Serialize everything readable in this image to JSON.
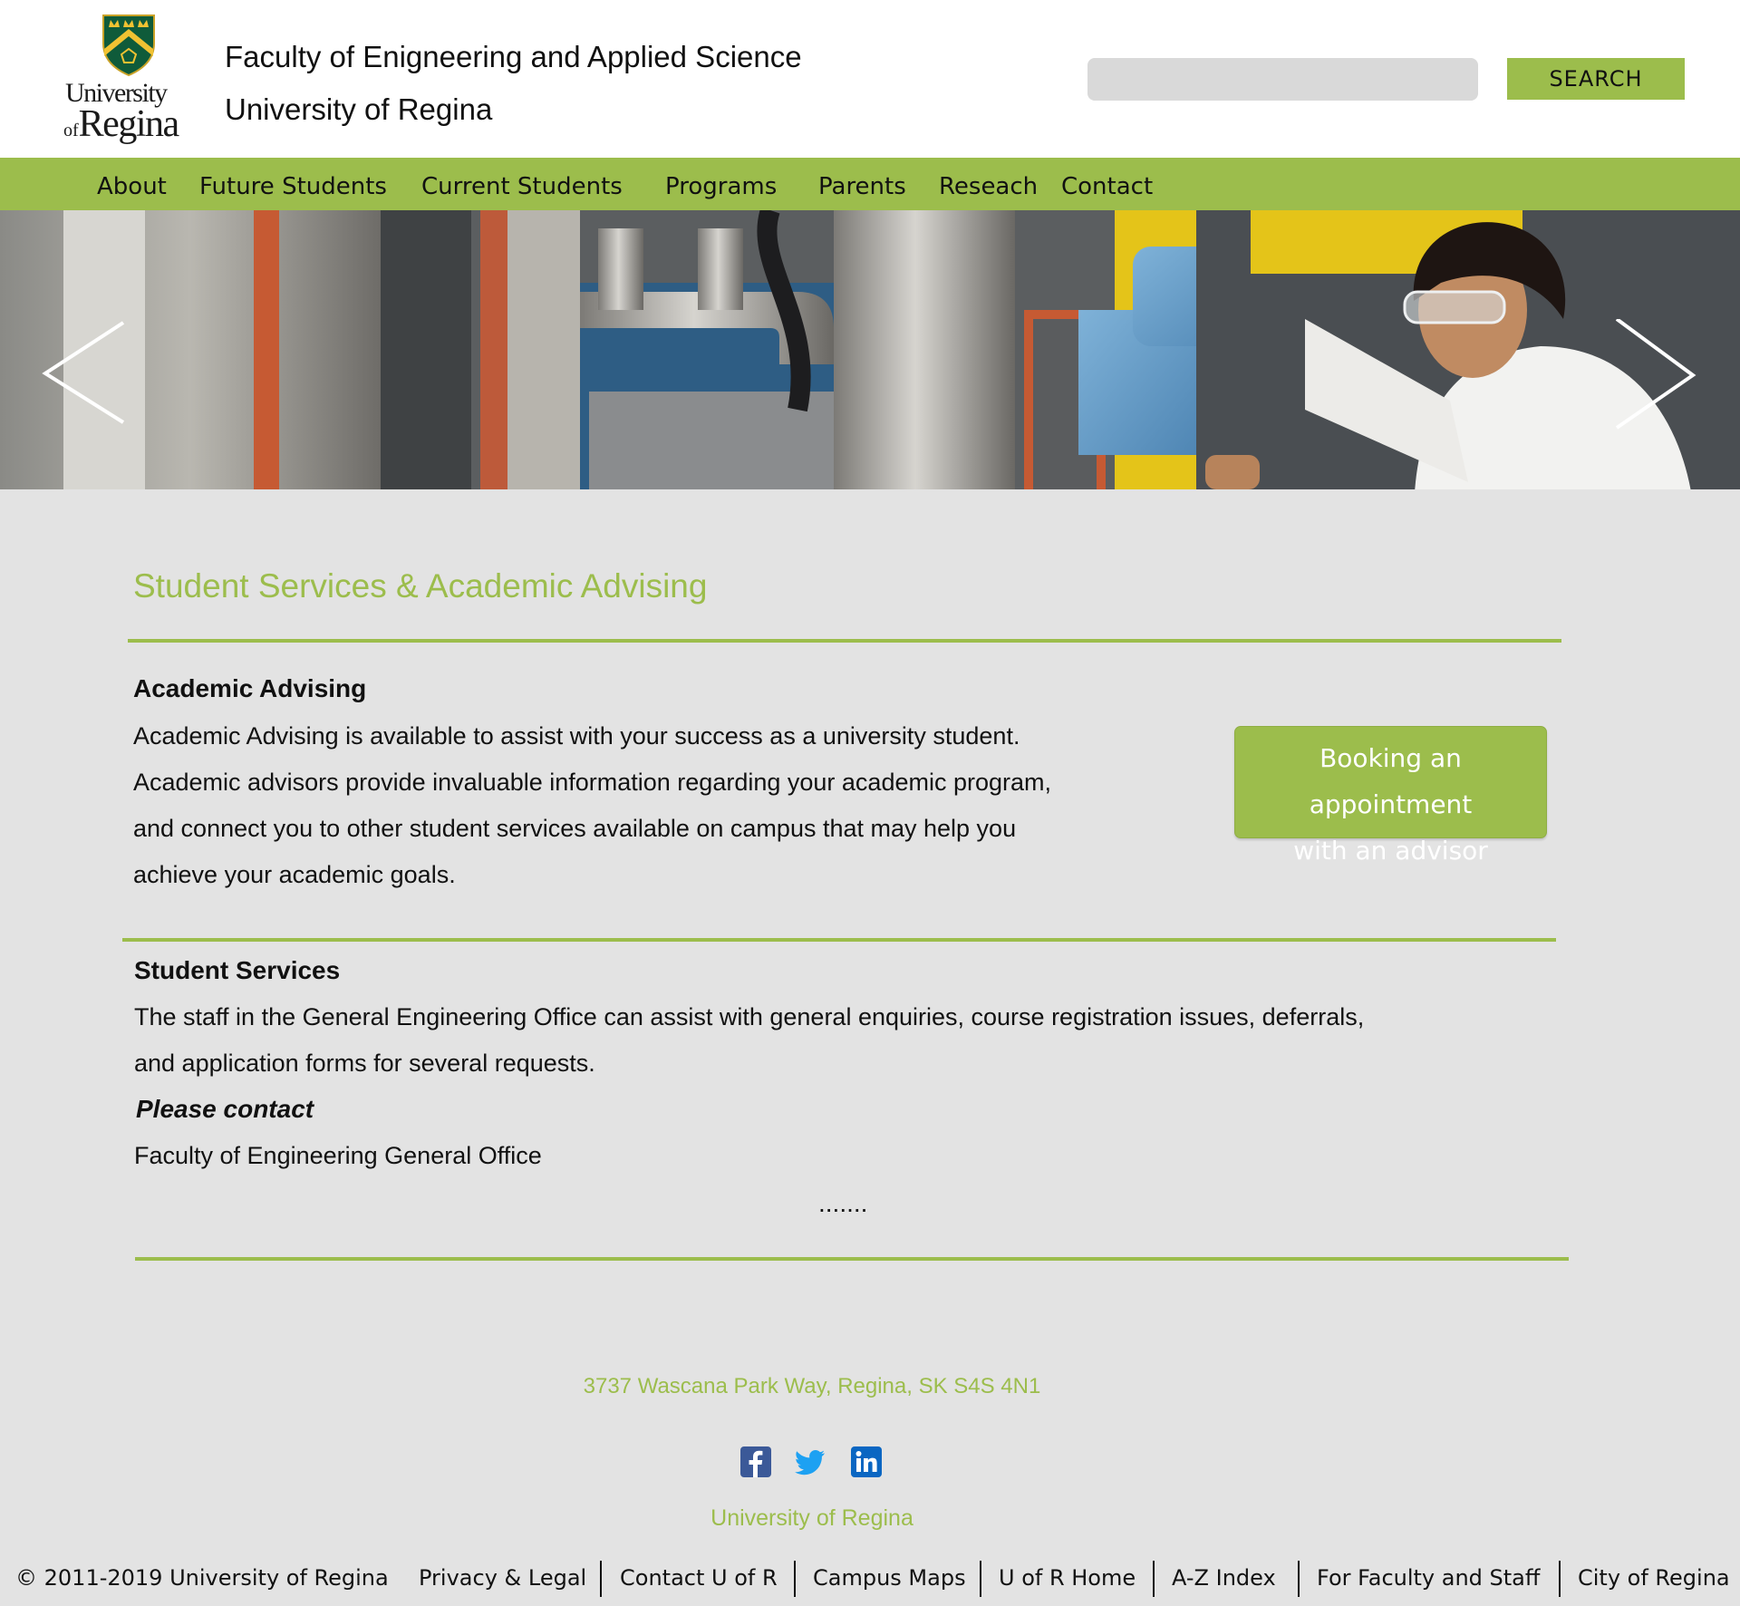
{
  "header": {
    "logo_line1": "University",
    "logo_of": "of",
    "logo_line2": "Regina",
    "title_line1": "Faculty of Enigneering and Applied Science",
    "title_line2": "University of Regina",
    "search_placeholder": "",
    "search_label": "SEARCH"
  },
  "nav": {
    "items": [
      "About",
      "Future Students",
      "Current Students",
      "Programs",
      "Parents",
      "Reseach",
      "Contact"
    ]
  },
  "hero": {
    "prev_icon": "chevron-left-icon",
    "next_icon": "chevron-right-icon"
  },
  "main": {
    "title": "Student Services & Academic Advising",
    "advising": {
      "heading": "Academic Advising",
      "lines": [
        "Academic Advising is available to assist with your success as a university student.",
        "Academic advisors provide invaluable information regarding your academic program,",
        "and connect you to other student services available on campus that may help you",
        "achieve your academic goals."
      ],
      "button_line1": "Booking an appointment",
      "button_line2": "with an advisor"
    },
    "services": {
      "heading": "Student Services",
      "lines": [
        "The staff in the General Engineering Office can assist with general enquiries, course registration issues, deferrals,",
        "and application forms for several requests."
      ],
      "contact_label": "Please contact",
      "contact_office": "Faculty of Engineering General Office",
      "more": "......."
    }
  },
  "footer": {
    "address": "3737 Wascana Park Way, Regina, SK S4S 4N1",
    "social": [
      "facebook-icon",
      "twitter-icon",
      "linkedin-icon"
    ],
    "university_link": "University of Regina",
    "copyright": "© 2011-2019 University of Regina",
    "links": [
      "Privacy & Legal",
      "Contact U of R",
      "Campus Maps",
      "U of R Home",
      "A-Z Index",
      "For Faculty and Staff",
      "City of Regina"
    ]
  },
  "colors": {
    "accent": "#9cbd4c",
    "background": "#e3e3e3",
    "search_field": "#d9d9d9",
    "shield_green": "#0f5b3a",
    "shield_gold": "#f1c232",
    "facebook": "#3b5998",
    "twitter": "#1da1f2",
    "linkedin": "#0a66c2"
  }
}
